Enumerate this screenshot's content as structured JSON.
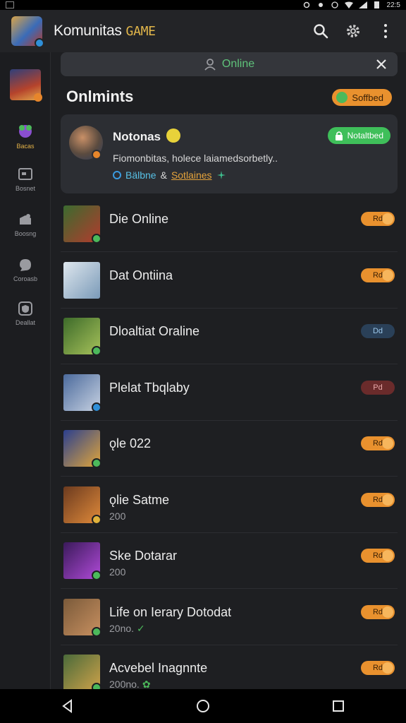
{
  "status_bar": {
    "time": "22:5"
  },
  "app_bar": {
    "title": "Komunitas",
    "title_accent": "GAME"
  },
  "sidebar": {
    "items": [
      {
        "label": "",
        "icon": "game-thumb"
      },
      {
        "label": "Bacas",
        "icon": "blob-icon"
      },
      {
        "label": "Bosnet",
        "icon": "box-icon"
      },
      {
        "label": "Boosng",
        "icon": "pin-icon"
      },
      {
        "label": "Coroasb",
        "icon": "chat-icon"
      },
      {
        "label": "Deallat",
        "icon": "shield-icon"
      }
    ]
  },
  "search": {
    "value": "Online"
  },
  "section": {
    "title": "Onlmints",
    "pill_label": "Soffbed"
  },
  "featured": {
    "name": "Notonas",
    "badge": "Notaltbed",
    "description": "Fiomonbitas, holece laiamedsorbetly..",
    "meta_1": "Bälbne",
    "meta_amp": "&",
    "meta_2": "Sotlaines"
  },
  "colors": {
    "accent": "#e9912e",
    "online": "#5fc27a",
    "background": "#1e1f22",
    "card": "#2c2e33"
  },
  "list": [
    {
      "title": "Die Online",
      "sub": "",
      "toggle": "Rd",
      "toggle_style": "on",
      "thumb": [
        "#3b6b2f",
        "#b23b2d"
      ],
      "check": "#4cb95b"
    },
    {
      "title": "Dat Ontiina",
      "sub": "",
      "toggle": "Rd",
      "toggle_style": "on",
      "thumb": [
        "#dfe7ee",
        "#7a9ab8"
      ],
      "check": ""
    },
    {
      "title": "Dloaltiat Oraline",
      "sub": "",
      "toggle": "Dd",
      "toggle_style": "blue",
      "thumb": [
        "#3d6a2a",
        "#a6c25a"
      ],
      "check": "#4cb95b"
    },
    {
      "title": "Plelat Tbqlaby",
      "sub": "",
      "toggle": "Pd",
      "toggle_style": "red",
      "thumb": [
        "#4b6a9c",
        "#c7d2e2"
      ],
      "check": "#2f8fd8"
    },
    {
      "title": "ǫle 022",
      "sub": "",
      "toggle": "Rd",
      "toggle_style": "on",
      "thumb": [
        "#2b3f8e",
        "#e0a63b"
      ],
      "check": "#4cb95b"
    },
    {
      "title": "ǫlie Satme",
      "sub": "200",
      "toggle": "Rd",
      "toggle_style": "on",
      "thumb": [
        "#6b3a1f",
        "#e08a3a"
      ],
      "check": "#e0b23b"
    },
    {
      "title": "Ske Dotarar",
      "sub": "200",
      "toggle": "Rd",
      "toggle_style": "on",
      "thumb": [
        "#3a1a5a",
        "#b04ad8"
      ],
      "check": "#4cb95b"
    },
    {
      "title": "Life on Ierary Dotodat",
      "sub": "20no.",
      "sub_mark": "✓",
      "toggle": "Rd",
      "toggle_style": "on",
      "thumb": [
        "#7a5a3a",
        "#c89060"
      ],
      "check": "#4cb95b"
    },
    {
      "title": "Acvebel Inagnnte",
      "sub": "200no.",
      "sub_mark": "✿",
      "toggle": "Rd",
      "toggle_style": "on",
      "thumb": [
        "#4a6a3a",
        "#d0a34a"
      ],
      "check": "#4cb95b"
    }
  ]
}
